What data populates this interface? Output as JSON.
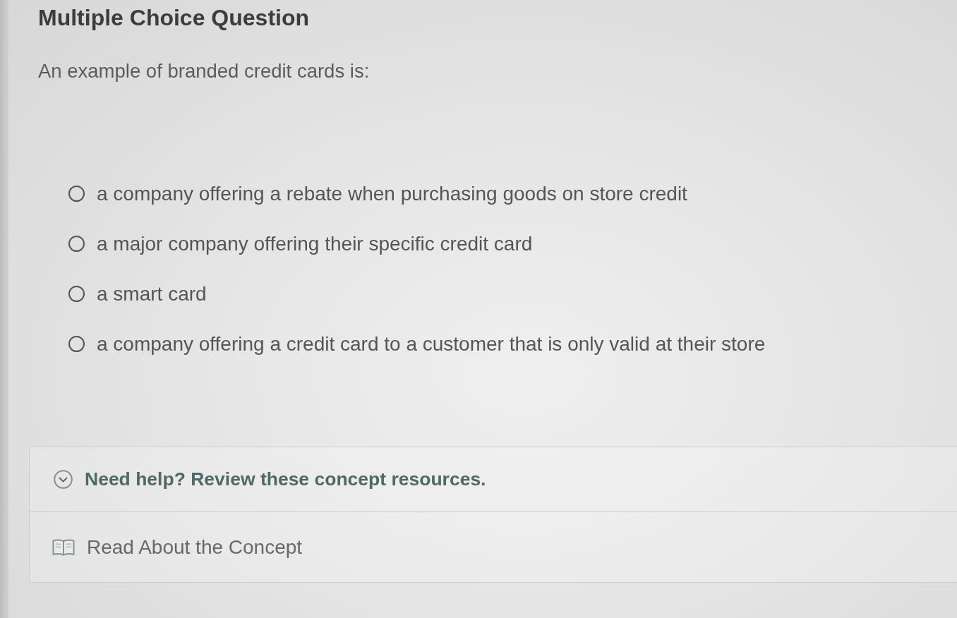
{
  "header": {
    "title": "Multiple Choice Question"
  },
  "question": {
    "prompt": "An example of branded credit cards is:"
  },
  "options": [
    {
      "label": "a company offering a rebate when purchasing goods on store credit",
      "selected": false
    },
    {
      "label": "a major company offering their specific credit card",
      "selected": false
    },
    {
      "label": "a smart card",
      "selected": false
    },
    {
      "label": "a company offering a credit card to a customer that is only valid at their store",
      "selected": false
    }
  ],
  "help_panel": {
    "title": "Need help? Review these concept resources.",
    "expanded": true,
    "resources": [
      {
        "label": "Read About the Concept"
      }
    ]
  }
}
